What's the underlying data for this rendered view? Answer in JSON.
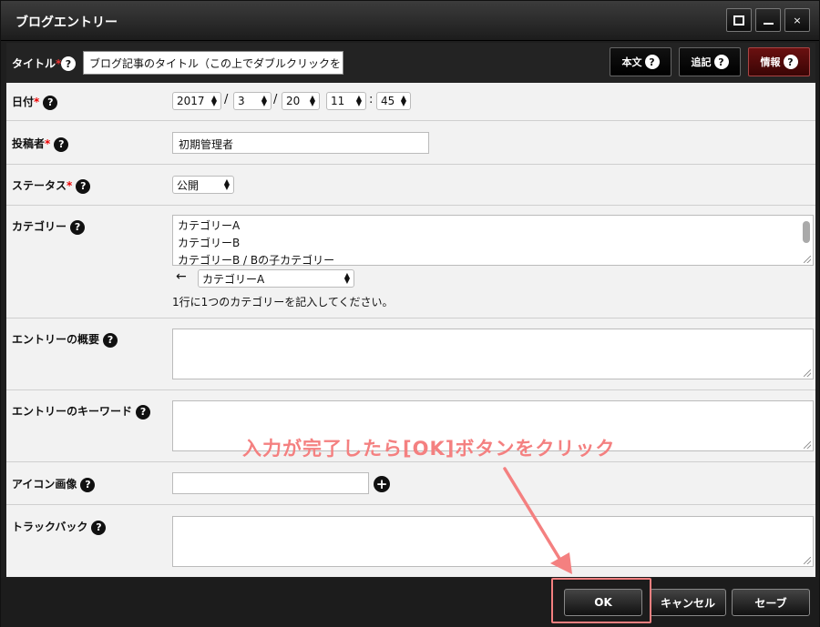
{
  "window": {
    "title": "ブログエントリー",
    "close_glyph": "×"
  },
  "toolbar": {
    "title_label": "タイトル",
    "required_mark": "*",
    "help_glyph": "?",
    "title_value": "ブログ記事のタイトル（この上でダブルクリックをし",
    "tabs": [
      {
        "label": "本文",
        "active": false
      },
      {
        "label": "追記",
        "active": false
      },
      {
        "label": "情報",
        "active": true
      }
    ]
  },
  "form": {
    "date": {
      "label": "日付",
      "year": "2017",
      "month": "3",
      "day": "20",
      "hour": "11",
      "minute": "45",
      "sep_slash": "/",
      "sep_colon": ":"
    },
    "author": {
      "label": "投稿者",
      "value": "初期管理者"
    },
    "status": {
      "label": "ステータス",
      "value": "公開"
    },
    "category": {
      "label": "カテゴリー",
      "lines": [
        "カテゴリーA",
        "カテゴリーB",
        "カテゴリーB / Bの子カテゴリー"
      ],
      "arrow": "←",
      "select_value": "カテゴリーA",
      "note": "1行に1つのカテゴリーを記入してください。"
    },
    "summary": {
      "label": "エントリーの概要"
    },
    "keywords": {
      "label": "エントリーのキーワード"
    },
    "icon_image": {
      "label": "アイコン画像",
      "add_glyph": "+"
    },
    "trackback": {
      "label": "トラックバック"
    }
  },
  "footer": {
    "ok_label": "OK",
    "cancel_label": "キャンセル",
    "save_label": "セーブ"
  },
  "annotation": {
    "text": "入力が完了したら[OK]ボタンをクリック",
    "color": "#f48080"
  }
}
